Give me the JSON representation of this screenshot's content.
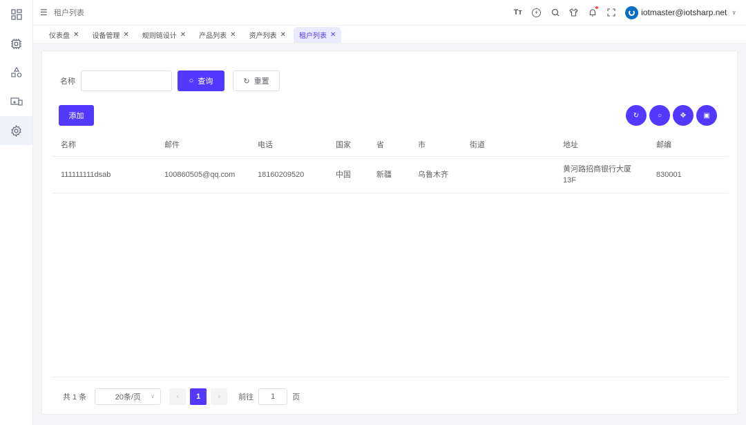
{
  "header": {
    "breadcrumb": "租户列表",
    "user": "iotmaster@iotsharp.net"
  },
  "tabs": [
    {
      "label": "仪表盘"
    },
    {
      "label": "设备管理"
    },
    {
      "label": "规则链设计"
    },
    {
      "label": "产品列表"
    },
    {
      "label": "资产列表"
    },
    {
      "label": "租户列表",
      "active": true
    }
  ],
  "search": {
    "label": "名称",
    "value": "",
    "query_label": "查询",
    "reset_label": "重置"
  },
  "toolbar": {
    "add_label": "添加"
  },
  "table": {
    "columns": [
      "名称",
      "邮件",
      "电话",
      "国家",
      "省",
      "市",
      "街道",
      "地址",
      "邮编"
    ],
    "rows": [
      [
        "111111111dsab",
        "100860505@qq.com",
        "18160209520",
        "中国",
        "新疆",
        "乌鲁木齐",
        "",
        "黄河路招商银行大厦13F",
        "830001"
      ]
    ]
  },
  "pagination": {
    "total": "共 1 条",
    "page_size": "20条/页",
    "current": "1",
    "goto_label": "前往",
    "goto_value": "1",
    "page_suffix": "页"
  },
  "colors": {
    "accent": "#5338ff"
  }
}
